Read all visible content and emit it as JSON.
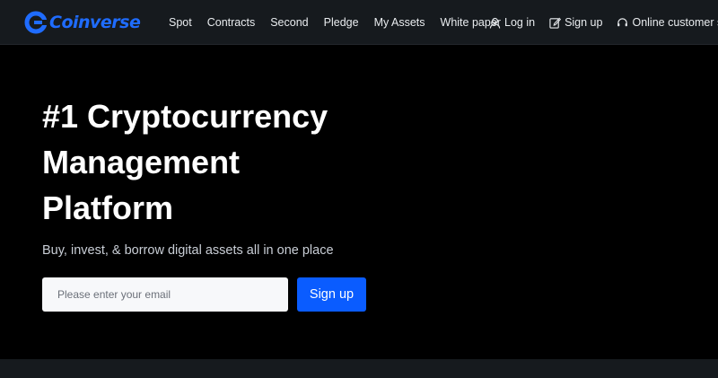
{
  "brand": {
    "name": "Coinverse",
    "color": "#1f6cff"
  },
  "nav": {
    "links": [
      "Spot",
      "Contracts",
      "Second",
      "Pledge",
      "My Assets",
      "White paper"
    ],
    "login": {
      "label": "Log in",
      "icon": "user-icon"
    },
    "signup": {
      "label": "Sign up",
      "icon": "edit-icon"
    },
    "support": {
      "label": "Online customer service",
      "icon": "headset-icon"
    }
  },
  "hero": {
    "title_lines": [
      "#1 Cryptocurrency",
      "Management",
      "Platform"
    ],
    "subtitle": "Buy, invest, & borrow digital assets all in one place",
    "email_placeholder": "Please enter your email",
    "signup_label": "Sign up",
    "accent_color": "#0a5cff"
  }
}
